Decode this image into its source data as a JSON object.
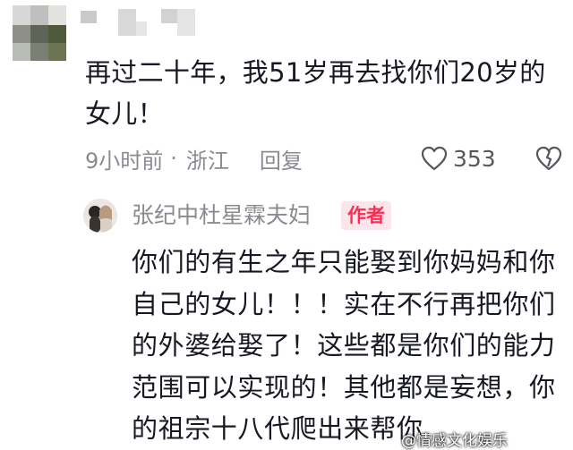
{
  "comment": {
    "text": "再过二十年，我51岁再去找你们20岁的女儿！",
    "time": "9小时前",
    "separator": "·",
    "location": "浙江",
    "reply_label": "回复",
    "like_count": "353"
  },
  "reply": {
    "username": "张纪中杜星霖夫妇",
    "badge": "作者",
    "text": "你们的有生之年只能娶到你妈妈和你自己的女儿！！！实在不行再把你们的外婆给娶了！这些都是你们的能力范围可以实现的！其他都是妄想，你的祖宗十八代爬出来帮你"
  },
  "watermark": "@情感文化娱乐",
  "colors": {
    "accent": "#fe2c55",
    "meta_gray": "#8a8b91",
    "text": "#161823"
  },
  "icons": [
    "heart-icon",
    "dislike-icon"
  ]
}
